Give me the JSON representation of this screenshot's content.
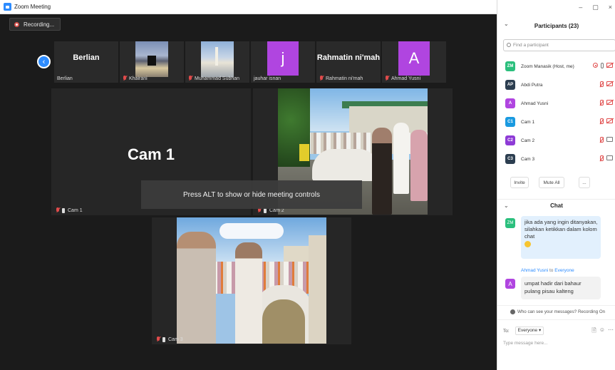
{
  "window": {
    "title": "Zoom Meeting"
  },
  "recording": {
    "label": "Recording..."
  },
  "thumbnails": [
    {
      "name": "Berlian",
      "label": "Berlian",
      "muted": false,
      "type": "name"
    },
    {
      "name": "",
      "label": "Khairani",
      "muted": true,
      "type": "photo-kaaba"
    },
    {
      "name": "",
      "label": "Muhammad Subhan",
      "muted": true,
      "type": "photo-mosque"
    },
    {
      "name": "j",
      "label": "jauhar isnan",
      "muted": false,
      "type": "avatar",
      "color": "#b045e0"
    },
    {
      "name": "Rahmatin ni'mah",
      "label": "Rahmatin ni'mah",
      "muted": true,
      "type": "name"
    },
    {
      "name": "A",
      "label": "Ahmad Yusni",
      "muted": true,
      "type": "avatar",
      "color": "#b045e0"
    }
  ],
  "tiles": {
    "cam1": {
      "big_name": "Cam 1",
      "label": "Cam 1"
    },
    "cam2": {
      "label": "Cam 2"
    },
    "cam3": {
      "label": "Cam 3"
    }
  },
  "toast": "Press ALT to show or hide meeting controls",
  "window_controls": {
    "minimize": "–",
    "restore": "▢",
    "close": "×"
  },
  "participants": {
    "title": "Participants (23)",
    "search_placeholder": "Find a participant",
    "list": [
      {
        "initials": "ZM",
        "name": "Zoom Manasik (Host, me)",
        "color": "#2bbf7d",
        "mic": "on",
        "cam": "off",
        "rec": true
      },
      {
        "initials": "AP",
        "name": "Abdi Putra",
        "color": "#2c3e50",
        "mic": "off",
        "cam": "off",
        "rec": false
      },
      {
        "initials": "A",
        "name": "Ahmad Yusni",
        "color": "#b045e0",
        "mic": "off",
        "cam": "off",
        "rec": false
      },
      {
        "initials": "C1",
        "name": "Cam 1",
        "color": "#1a9ae0",
        "mic": "off",
        "cam": "off",
        "rec": false
      },
      {
        "initials": "C2",
        "name": "Cam 2",
        "color": "#8e3bd6",
        "mic": "off",
        "cam": "on",
        "rec": false
      },
      {
        "initials": "C3",
        "name": "Cam 3",
        "color": "#2c3e50",
        "mic": "off",
        "cam": "on",
        "rec": false
      }
    ],
    "invite_label": "Invite",
    "mute_all_label": "Mute All",
    "more_label": "..."
  },
  "chat": {
    "title": "Chat",
    "messages": [
      {
        "initials": "ZM",
        "text": "jika ada yang ingin ditanyakan, silahkan ketikkan dalam kolom chat"
      },
      {
        "sender": "Ahmad Yusni",
        "to": "to",
        "recipient": "Everyone",
        "initials": "A",
        "text": "umpat hadir dari bahaur pulang pisau kalteng"
      }
    ],
    "visibility_note": "Who can see your messages? Recording On",
    "to_label": "To:",
    "to_value": "Everyone",
    "input_placeholder": "Type message here..."
  }
}
